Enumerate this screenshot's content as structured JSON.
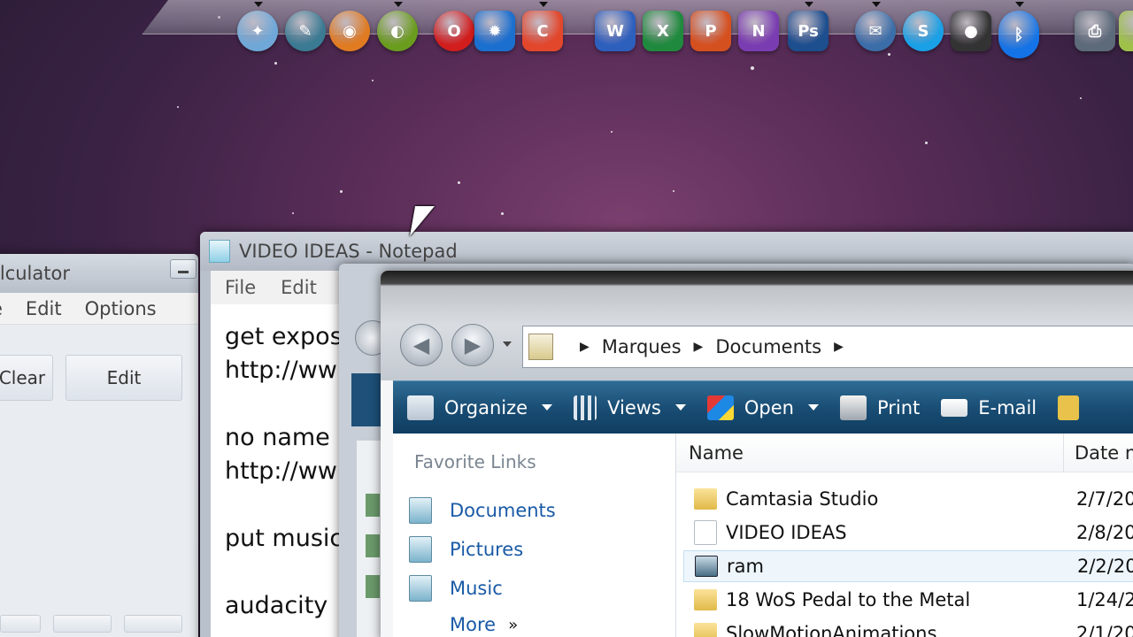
{
  "dock": {
    "icons": [
      {
        "name": "safari-icon",
        "color": "#6fa8d8",
        "glyph": "✦"
      },
      {
        "name": "camtasia-icon",
        "color": "#3a7a92",
        "glyph": "✎"
      },
      {
        "name": "firefox-icon",
        "color": "#e07b22",
        "glyph": "◉"
      },
      {
        "name": "nvidia-icon",
        "color": "#6a9c1e",
        "glyph": "◐"
      },
      {
        "name": "opera-icon",
        "color": "#d21d1d",
        "glyph": "O"
      },
      {
        "name": "starburst-icon",
        "color": "#1b6fcf",
        "glyph": "✹"
      },
      {
        "name": "ccleaner-icon",
        "color": "#e2472c",
        "glyph": "C"
      },
      {
        "name": "word-icon",
        "color": "#2d5fbd",
        "glyph": "W"
      },
      {
        "name": "excel-icon",
        "color": "#1f8a3d",
        "glyph": "X"
      },
      {
        "name": "powerpoint-icon",
        "color": "#d5501f",
        "glyph": "P"
      },
      {
        "name": "onenote-icon",
        "color": "#7a3db1",
        "glyph": "N"
      },
      {
        "name": "photoshop-icon",
        "color": "#1d4e8e",
        "glyph": "Ps"
      },
      {
        "name": "thunderbird-icon",
        "color": "#3b6ea8",
        "glyph": "✉"
      },
      {
        "name": "skype-icon",
        "color": "#19a0e6",
        "glyph": "S"
      },
      {
        "name": "camera-icon",
        "color": "#333333",
        "glyph": "●"
      },
      {
        "name": "bluetooth-icon",
        "color": "#1473e6",
        "glyph": "ᛒ"
      },
      {
        "name": "printer-settings-icon",
        "color": "#5d6a7a",
        "glyph": "⎙"
      },
      {
        "name": "notes-icon",
        "color": "#9fc14a",
        "glyph": "▤"
      }
    ]
  },
  "calculator": {
    "title": "alculator",
    "menu": [
      "e",
      "Edit",
      "Options"
    ],
    "buttons": [
      "Clear",
      "Edit"
    ]
  },
  "notepad": {
    "title": "VIDEO IDEAS - Notepad",
    "menu": [
      "File",
      "Edit"
    ],
    "lines": [
      "get expos",
      "http://ww",
      "",
      "no name",
      "http://ww",
      "",
      "put music",
      "",
      "audacity"
    ]
  },
  "explorer": {
    "breadcrumb": [
      "Marques",
      "Documents"
    ],
    "toolbar": [
      {
        "label": "Organize",
        "icon": "organize-icon",
        "dropdown": true
      },
      {
        "label": "Views",
        "icon": "views-icon",
        "dropdown": true
      },
      {
        "label": "Open",
        "icon": "open-icon",
        "dropdown": true
      },
      {
        "label": "Print",
        "icon": "print-icon",
        "dropdown": false
      },
      {
        "label": "E-mail",
        "icon": "email-icon",
        "dropdown": false
      }
    ],
    "favorites_header": "Favorite Links",
    "favorites": [
      "Documents",
      "Pictures",
      "Music",
      "More"
    ],
    "columns": {
      "name": "Name",
      "date": "Date n"
    },
    "files": [
      {
        "name": "Camtasia Studio",
        "date": "2/7/20",
        "type": "folder"
      },
      {
        "name": "VIDEO IDEAS",
        "date": "2/8/20",
        "type": "text"
      },
      {
        "name": "ram",
        "date": "2/2/20",
        "type": "app"
      },
      {
        "name": "18 WoS Pedal to the Metal",
        "date": "1/24/2",
        "type": "folder"
      },
      {
        "name": "SlowMotionAnimations",
        "date": "2/1/20",
        "type": "folder"
      }
    ]
  }
}
